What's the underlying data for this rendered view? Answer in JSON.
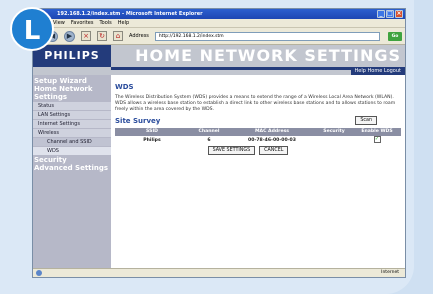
{
  "badge": {
    "letter": "L",
    "color": "#1f7fd1"
  },
  "browser": {
    "title": "192.168.1.2/index.stm - Microsoft Internet Explorer",
    "menu": [
      "View",
      "Favorites",
      "Tools",
      "Help"
    ],
    "address_label": "Address",
    "address": "http://192.168.1.2/index.stm",
    "go": "Go",
    "status_zone": "Internet"
  },
  "header": {
    "logo": "PHILIPS",
    "title": "HOME NETWORK SETTINGS",
    "links": "Help  Home  Logout"
  },
  "sidebar": {
    "setup_wizard": "Setup Wizard",
    "home_network": "Home Network Settings",
    "items": [
      "Status",
      "LAN Settings",
      "Internet Settings",
      "Wireless"
    ],
    "sub_items": [
      "Channel and SSID",
      "WDS"
    ],
    "security": "Security",
    "advanced": "Advanced Settings"
  },
  "content": {
    "title": "WDS",
    "description": "The Wireless Distribution System (WDS) provides a means to extend the range of a Wireless Local Area Network (WLAN). WDS allows a wireless base station to establish a direct link to other wireless base stations and to allows stations to roam freely within the area covered by the WDS.",
    "survey_title": "Site Survey",
    "scan": "Scan",
    "columns": [
      "SSID",
      "Channel",
      "MAC Address",
      "Security",
      "Enable WDS"
    ],
    "rows": [
      {
        "ssid": "Philips",
        "channel": "6",
        "mac": "00-78-46-00-00-03",
        "security": "",
        "enabled": "✓"
      }
    ],
    "save": "SAVE SETTINGS",
    "cancel": "CANCEL"
  }
}
